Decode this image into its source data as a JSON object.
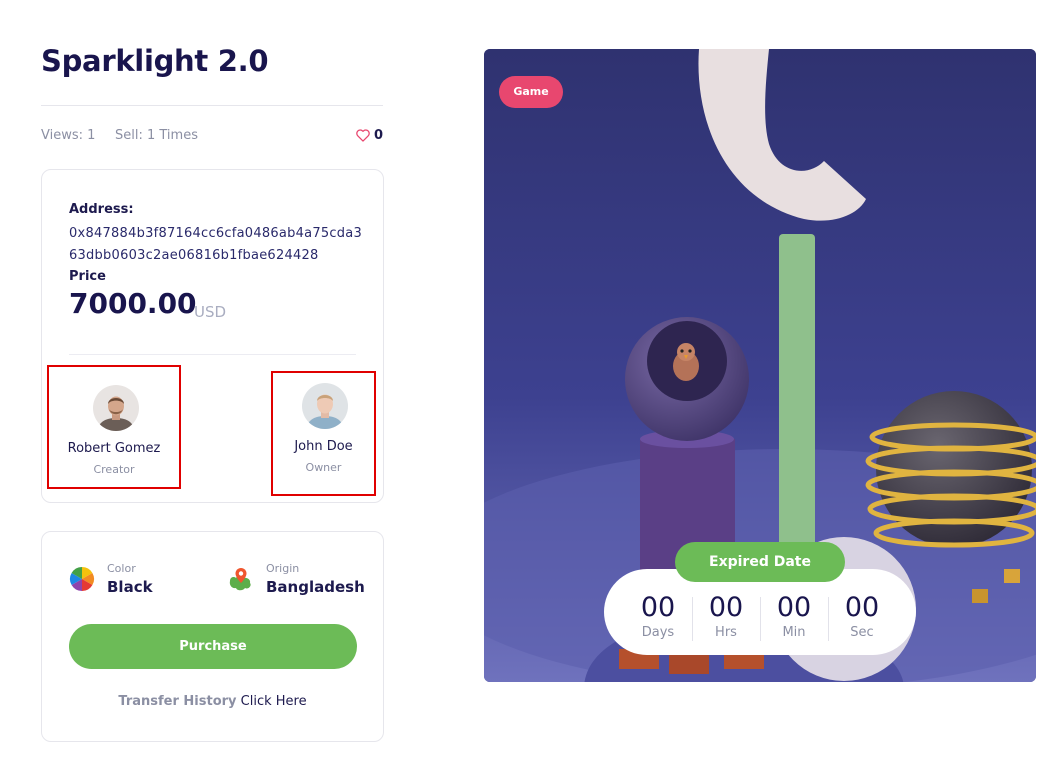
{
  "item": {
    "title": "Sparklight 2.0",
    "views": "Views: 1",
    "sell": "Sell: 1 Times",
    "likes": "0"
  },
  "info": {
    "address_label": "Address:",
    "address_value": "0x847884b3f87164cc6cfa0486ab4a75cda363dbb0603c2ae06816b1fbae624428",
    "price_label": "Price",
    "price_value": "7000.00",
    "price_currency": "USD"
  },
  "people": {
    "creator": {
      "name": "Robert Gomez",
      "role": "Creator"
    },
    "owner": {
      "name": "John Doe",
      "role": "Owner"
    }
  },
  "attributes": {
    "color_label": "Color",
    "color_value": "Black",
    "origin_label": "Origin",
    "origin_value": "Bangladesh"
  },
  "actions": {
    "purchase_label": "Purchase",
    "transfer_history": "Transfer History",
    "click_here": "Click Here"
  },
  "hero": {
    "category_badge": "Game",
    "expired_label": "Expired Date",
    "countdown": [
      {
        "value": "00",
        "unit": "Days"
      },
      {
        "value": "00",
        "unit": "Hrs"
      },
      {
        "value": "00",
        "unit": "Min"
      },
      {
        "value": "00",
        "unit": "Sec"
      }
    ]
  },
  "colors": {
    "accent_green": "#6cbb57",
    "badge_pink": "#e8476f",
    "heading_navy": "#19154d",
    "highlight_red": "#e00000"
  },
  "icons": {
    "like": "heart-icon",
    "color": "color-wheel-icon",
    "origin": "map-pin-icon"
  }
}
